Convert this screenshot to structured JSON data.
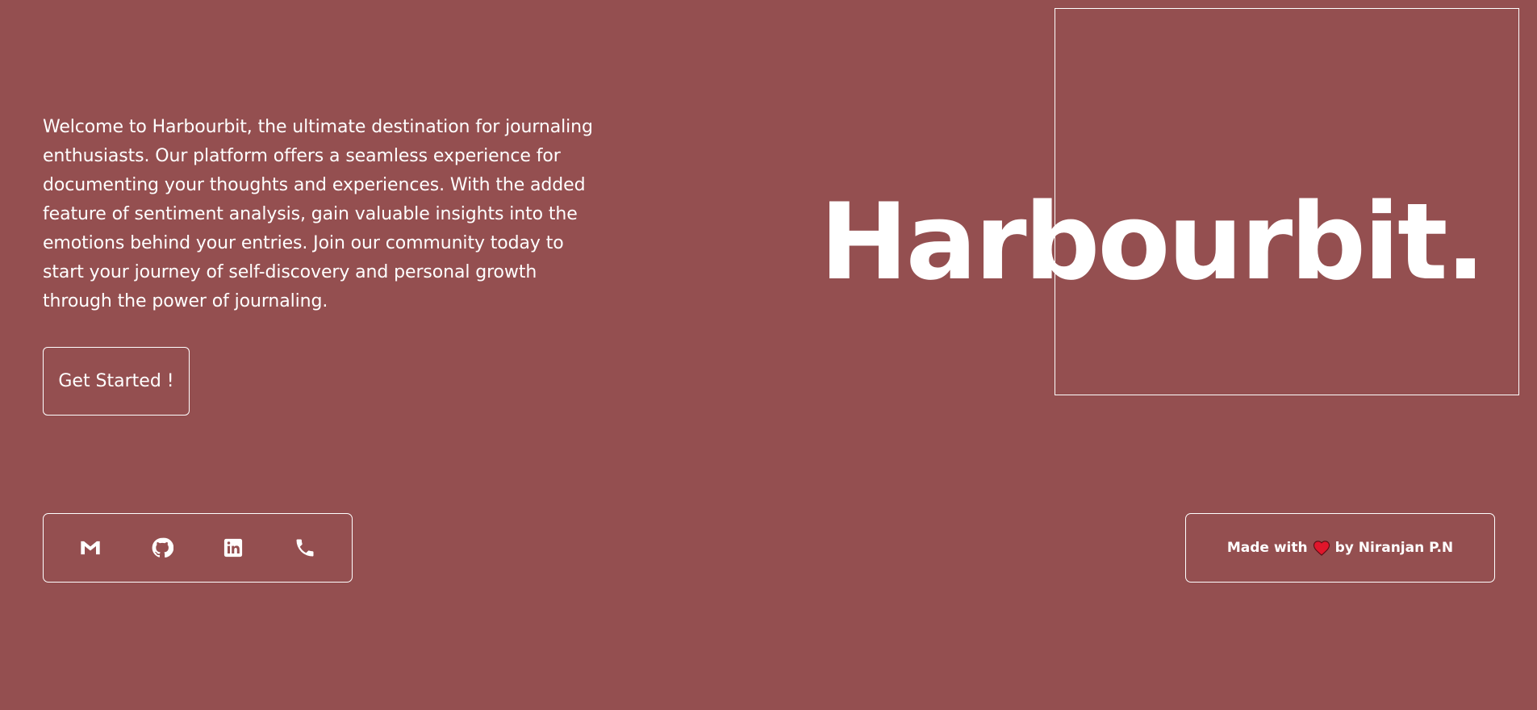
{
  "intro": {
    "text": "Welcome to Harbourbit, the ultimate destination for journaling enthusiasts. Our platform offers a seamless experience for documenting your thoughts and experiences. With the added feature of sentiment analysis, gain valuable insights into the emotions behind your entries. Join our community today to start your journey of self-discovery and personal growth through the power of journaling."
  },
  "cta": {
    "label": "Get Started !"
  },
  "brand": {
    "title": "Harbourbit."
  },
  "social": {
    "icons": [
      "gmail-icon",
      "github-icon",
      "linkedin-icon",
      "phone-icon"
    ]
  },
  "footer": {
    "made_with": "Made with",
    "by": "by Niranjan P.N"
  },
  "colors": {
    "background": "#944f50",
    "foreground": "#ffffff",
    "heart": "#e0162b"
  }
}
